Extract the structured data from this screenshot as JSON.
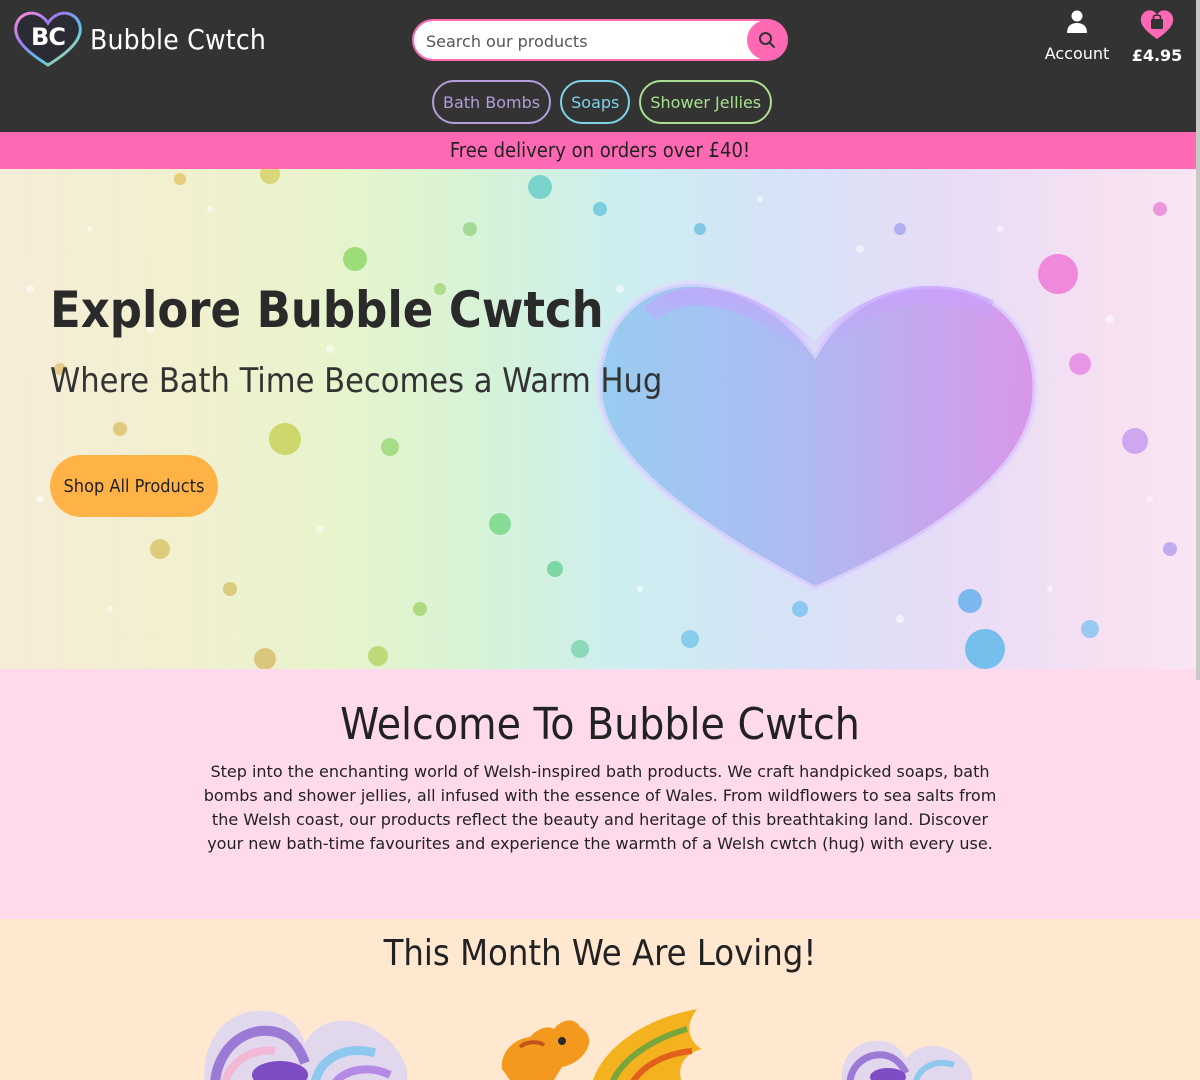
{
  "brand": {
    "initials": "BC",
    "name": "Bubble Cwtch"
  },
  "search": {
    "placeholder": "Search our products"
  },
  "account": {
    "label": "Account"
  },
  "cart": {
    "total": "£4.95"
  },
  "nav": {
    "items": [
      {
        "label": "Bath Bombs",
        "color": "#b39ddb"
      },
      {
        "label": "Soaps",
        "color": "#7fd3e8"
      },
      {
        "label": "Shower Jellies",
        "color": "#a8e08f"
      }
    ]
  },
  "announcement": {
    "text": "Free delivery on orders over £40!"
  },
  "hero": {
    "title": "Explore Bubble Cwtch",
    "subtitle": "Where Bath Time Becomes a Warm Hug",
    "cta": "Shop All Products"
  },
  "welcome": {
    "title": "Welcome To Bubble Cwtch",
    "body": "Step into the enchanting world of Welsh-inspired bath products. We craft handpicked soaps, bath bombs and shower jellies, all infused with the essence of Wales. From wildflowers to sea salts from the Welsh coast, our products reflect the beauty and heritage of this breathtaking land. Discover your new bath-time favourites and experience the warmth of a Welsh cwtch (hug) with every use."
  },
  "loving": {
    "title": "This Month We Are Loving!"
  },
  "colors": {
    "header": "#333333",
    "accent": "#ff69b4",
    "cta": "#ffb347",
    "welcome_bg": "#ffd9ec",
    "loving_bg": "#ffe8cf"
  },
  "icons": [
    "heart-logo-icon",
    "search-icon",
    "user-icon",
    "shopping-bag-heart-icon"
  ]
}
